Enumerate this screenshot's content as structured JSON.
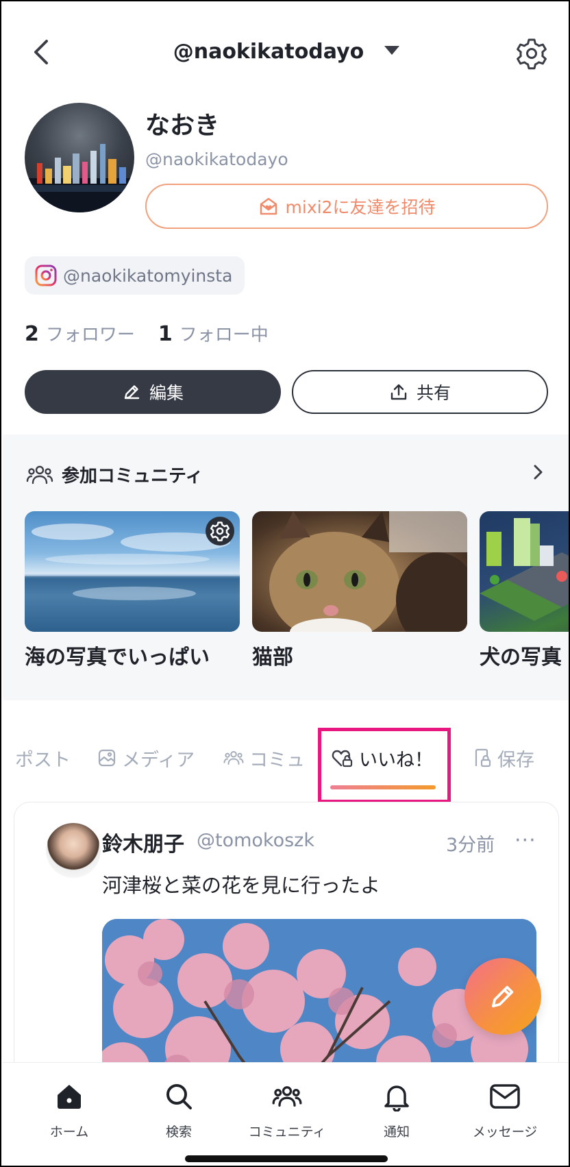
{
  "header": {
    "title": "@naokikatodayo",
    "back_icon": "chevron-left-icon",
    "settings_icon": "gear-icon"
  },
  "profile": {
    "display_name": "なおき",
    "username": "@naokikatodayo",
    "invite_label": "mixi2に友達を招待",
    "instagram_handle": "@naokikatomyinsta",
    "followers_count": "2",
    "followers_label": "フォロワー",
    "following_count": "1",
    "following_label": "フォロー中",
    "edit_label": "編集",
    "share_label": "共有"
  },
  "communities": {
    "title": "参加コミュニティ",
    "items": [
      {
        "name": "海の写真でいっぱい"
      },
      {
        "name": "猫部"
      },
      {
        "name": "犬の写真"
      }
    ]
  },
  "tabs": [
    {
      "label": "ポスト",
      "icon": ""
    },
    {
      "label": "メディア",
      "icon": "image-icon"
    },
    {
      "label": "コミュ",
      "icon": "people-icon"
    },
    {
      "label": "いいね！",
      "icon": "heart-lock-icon",
      "active": true
    },
    {
      "label": "保存",
      "icon": "bookmark-lock-icon"
    }
  ],
  "post": {
    "author": "鈴木朋子",
    "handle": "@tomokoszk",
    "time": "3分前",
    "more": "···",
    "text": "河津桜と菜の花を見に行ったよ"
  },
  "bottom_nav": [
    {
      "label": "ホーム",
      "icon": "home-icon"
    },
    {
      "label": "検索",
      "icon": "search-icon"
    },
    {
      "label": "コミュニティ",
      "icon": "community-icon"
    },
    {
      "label": "通知",
      "icon": "bell-icon"
    },
    {
      "label": "メッセージ",
      "icon": "mail-icon"
    }
  ],
  "colors": {
    "accent_gradient_start": "#ee7f93",
    "accent_gradient_end": "#f39a2b",
    "highlight": "#e8177f",
    "dark_button": "#363a45"
  }
}
